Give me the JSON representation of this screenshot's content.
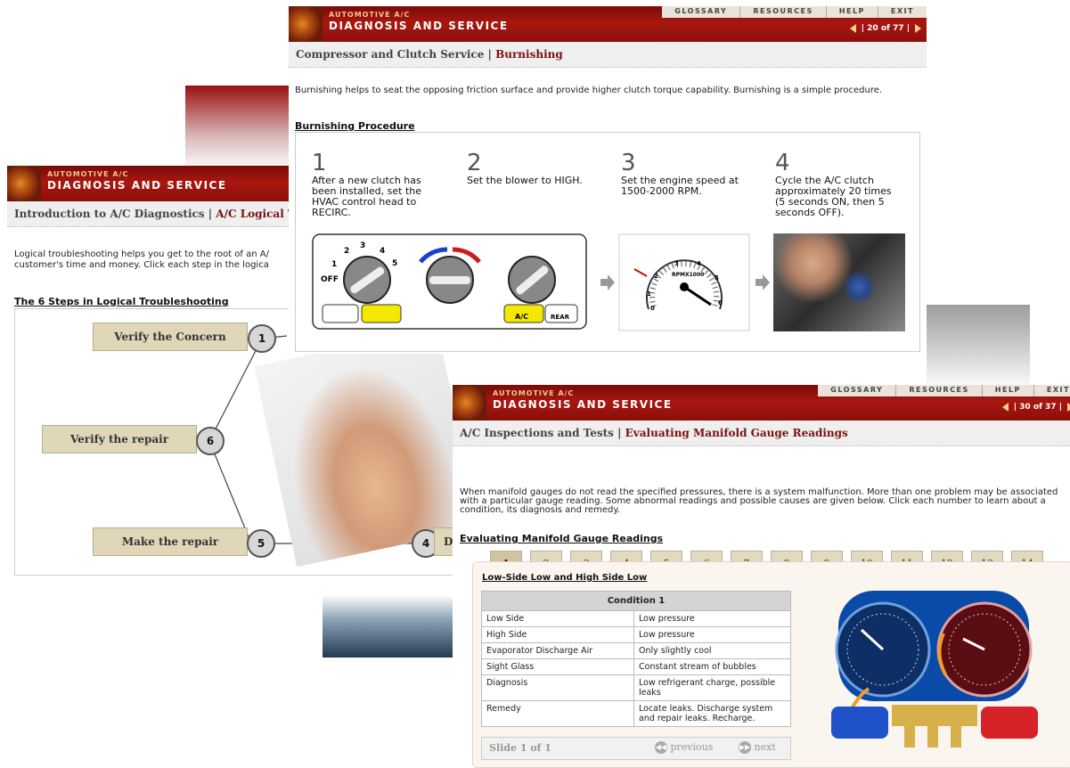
{
  "brand": {
    "sub": "AUTOMOTIVE A/C",
    "title": "DIAGNOSIS AND SERVICE"
  },
  "topnav": [
    "GLOSSARY",
    "RESOURCES",
    "HELP",
    "EXIT"
  ],
  "win_left": {
    "breadcrumb_section": "Introduction to A/C Diagnostics |",
    "breadcrumb_current": "A/C Logical Tro",
    "intro": "Logical troubleshooting helps you get to the root of an A/",
    "intro2": "customer's time and money. Click each step in the logica",
    "section": "The 6 Steps in Logical Troubleshooting",
    "steps": [
      "Verify the Concern",
      "Verify the repair",
      "Make the repair",
      "Di"
    ],
    "nums": [
      "1",
      "6",
      "5",
      "4"
    ]
  },
  "win_top": {
    "pager": "| 20 of 77 |",
    "breadcrumb_section": "Compressor and Clutch Service |",
    "breadcrumb_current": "Burnishing",
    "intro": "Burnishing helps to seat the opposing friction surface and provide higher clutch torque capability. Burnishing is a simple procedure.",
    "section": "Burnishing Procedure",
    "steps": [
      {
        "n": "1",
        "text": "After a new clutch has been installed, set the HVAC control head to RECIRC."
      },
      {
        "n": "2",
        "text": "Set the blower to HIGH."
      },
      {
        "n": "3",
        "text": "Set the engine speed at 1500-2000 RPM."
      },
      {
        "n": "4",
        "text": "Cycle the A/C clutch approximately 20 times (5 seconds ON, then 5 seconds OFF)."
      }
    ],
    "hvac_labels": {
      "off": "OFF",
      "one": "1",
      "two": "2",
      "three": "3",
      "four": "4",
      "five": "5",
      "ac": "A/C",
      "rear": "REAR"
    },
    "tach_labels": {
      "unit": "RPMX1000",
      "t0": "0",
      "t1": "1",
      "t2": "2",
      "t3": "3",
      "t4": "4",
      "t5": "5",
      "t6": "6"
    }
  },
  "win_bottom": {
    "pager": "| 30 of 37 |",
    "breadcrumb_section": "A/C Inspections and Tests |",
    "breadcrumb_current": "Evaluating Manifold Gauge Readings",
    "intro": "When manifold gauges do not read the specified pressures, there is a system malfunction. More than one problem may be associated with a particular gauge reading. Some abnormal readings and possible causes are given below. Click each number to learn about a condition, its diagnosis and remedy.",
    "section": "Evaluating Manifold Gauge Readings",
    "numbers": [
      "1",
      "2",
      "3",
      "4",
      "5",
      "6",
      "7",
      "8",
      "9",
      "10",
      "11",
      "12",
      "13",
      "14"
    ],
    "selected": "1",
    "panel_title": "Low-Side Low and High Side Low",
    "table_title": "Condition 1",
    "rows": [
      [
        "Low Side",
        "Low pressure"
      ],
      [
        "High Side",
        "Low pressure"
      ],
      [
        "Evaporator Discharge Air",
        "Only slightly cool"
      ],
      [
        "Sight Glass",
        "Constant stream of bubbles"
      ],
      [
        "Diagnosis",
        "Low refrigerant charge, possible leaks"
      ],
      [
        "Remedy",
        "Locate leaks. Discharge system and repair leaks. Recharge."
      ]
    ],
    "slide": "Slide 1 of 1",
    "prev": "previous",
    "next": "next"
  }
}
